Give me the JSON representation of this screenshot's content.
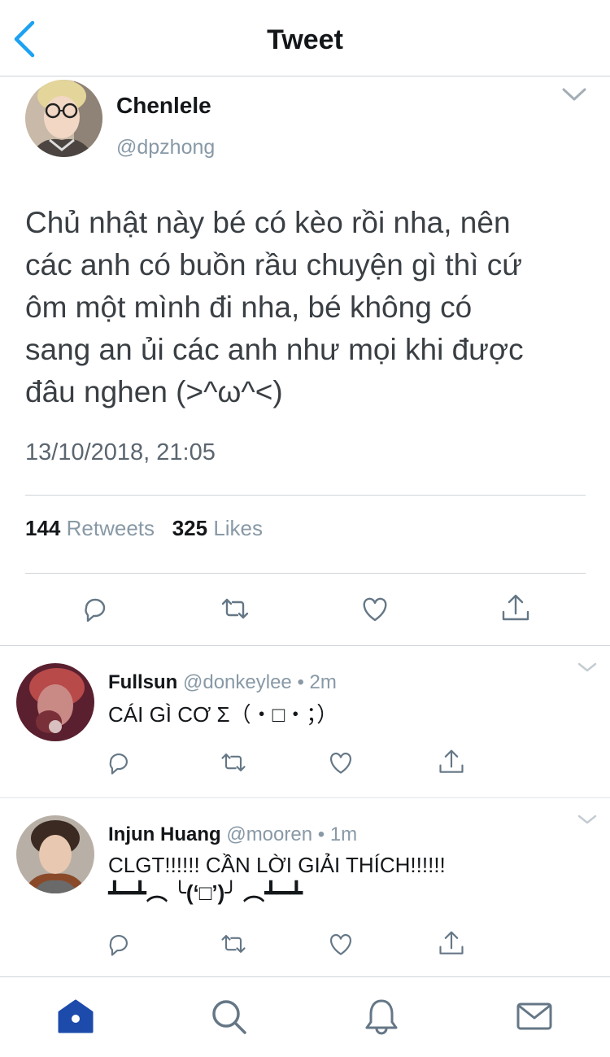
{
  "header": {
    "title": "Tweet",
    "back_icon": "chevron-left-icon",
    "accent": "#1da1f2"
  },
  "tweet": {
    "author_name": "Chenlele",
    "author_handle": "@dpzhong",
    "text_lines": [
      "Chủ nhật này bé có kèo rồi nha, nên",
      "các anh có buồn rầu chuyện gì thì cứ",
      "ôm một mình đi nha, bé không có",
      "sang an ủi các anh như mọi khi được",
      "đâu nghen (>^ω^<)"
    ],
    "timestamp": "13/10/2018, 21:05",
    "retweets_count": "144",
    "retweets_label": "Retweets",
    "likes_count": "325",
    "likes_label": "Likes"
  },
  "replies": [
    {
      "name": "Fullsun",
      "handle": "@donkeylee",
      "time": "• 2m",
      "lines": [
        "CÁI GÌ CƠ Σ（・□・；）"
      ]
    },
    {
      "name": "Injun Huang",
      "handle": "@mooren",
      "time": "• 1m",
      "lines": [
        "CLGT!!!!!! CẦN LỜI GIẢI THÍCH!!!!!!",
        "┻━┻︵ ╰(‘□’)╯ ︵┻━┻"
      ]
    }
  ],
  "tabbar": {
    "active_color": "#1c4bab",
    "tabs": [
      "home-icon",
      "search-icon",
      "notifications-icon",
      "messages-icon"
    ]
  }
}
